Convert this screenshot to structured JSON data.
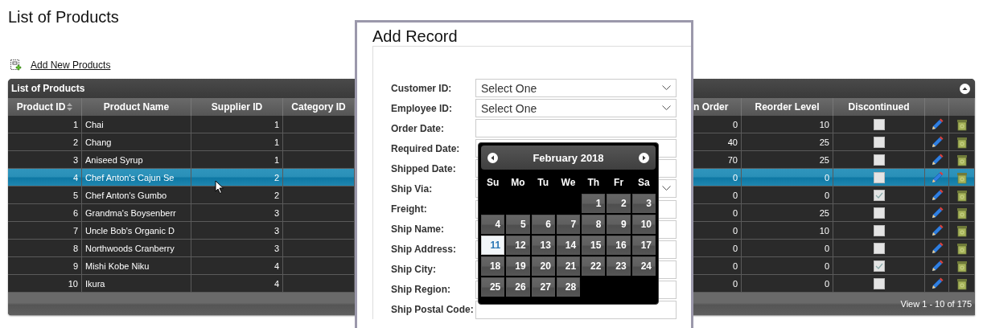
{
  "page_title": "List of Products",
  "add_link": "Add New Products",
  "grid": {
    "caption": "List of Products",
    "columns": [
      {
        "label": "Product ID",
        "sort_icon": true
      },
      {
        "label": "Product Name",
        "sort_icon": false
      },
      {
        "label": "Supplier ID",
        "sort_icon": false
      },
      {
        "label": "Category ID",
        "sort_icon": false
      },
      {
        "label": "n Order",
        "sort_icon": false
      },
      {
        "label": "Reorder Level",
        "sort_icon": false
      },
      {
        "label": "Discontinued",
        "sort_icon": false
      }
    ],
    "rows": [
      {
        "product_id": "1",
        "product_name": "Chai",
        "supplier_id": "1",
        "on_order": "0",
        "reorder_level": "10",
        "discontinued": false,
        "selected": false
      },
      {
        "product_id": "2",
        "product_name": "Chang",
        "supplier_id": "1",
        "on_order": "40",
        "reorder_level": "25",
        "discontinued": false,
        "selected": false
      },
      {
        "product_id": "3",
        "product_name": "Aniseed Syrup",
        "supplier_id": "1",
        "on_order": "70",
        "reorder_level": "25",
        "discontinued": false,
        "selected": false
      },
      {
        "product_id": "4",
        "product_name": "Chef Anton's Cajun Se",
        "supplier_id": "2",
        "on_order": "0",
        "reorder_level": "0",
        "discontinued": false,
        "selected": true
      },
      {
        "product_id": "5",
        "product_name": "Chef Anton's Gumbo",
        "supplier_id": "2",
        "on_order": "0",
        "reorder_level": "0",
        "discontinued": true,
        "selected": false
      },
      {
        "product_id": "6",
        "product_name": "Grandma's Boysenberr",
        "supplier_id": "3",
        "on_order": "0",
        "reorder_level": "25",
        "discontinued": false,
        "selected": false
      },
      {
        "product_id": "7",
        "product_name": "Uncle Bob's Organic D",
        "supplier_id": "3",
        "on_order": "0",
        "reorder_level": "10",
        "discontinued": false,
        "selected": false
      },
      {
        "product_id": "8",
        "product_name": "Northwoods Cranberry",
        "supplier_id": "3",
        "on_order": "0",
        "reorder_level": "0",
        "discontinued": false,
        "selected": false
      },
      {
        "product_id": "9",
        "product_name": "Mishi Kobe Niku",
        "supplier_id": "4",
        "on_order": "0",
        "reorder_level": "0",
        "discontinued": true,
        "selected": false
      },
      {
        "product_id": "10",
        "product_name": "Ikura",
        "supplier_id": "4",
        "on_order": "0",
        "reorder_level": "0",
        "discontinued": false,
        "selected": false
      }
    ],
    "pager": "View 1 - 10 of 175"
  },
  "modal": {
    "title": "Add Record",
    "fields": [
      {
        "label": "Customer ID:",
        "kind": "select",
        "value": "Select One"
      },
      {
        "label": "Employee ID:",
        "kind": "select",
        "value": "Select One"
      },
      {
        "label": "Order Date:",
        "kind": "text"
      },
      {
        "label": "Required Date:",
        "kind": "text"
      },
      {
        "label": "Shipped Date:",
        "kind": "text"
      },
      {
        "label": "Ship Via:",
        "kind": "select"
      },
      {
        "label": "Freight:",
        "kind": "text"
      },
      {
        "label": "Ship Name:",
        "kind": "text"
      },
      {
        "label": "Ship Address:",
        "kind": "text"
      },
      {
        "label": "Ship City:",
        "kind": "text"
      },
      {
        "label": "Ship Region:",
        "kind": "text"
      },
      {
        "label": "Ship Postal Code:",
        "kind": "text"
      }
    ],
    "calendar": {
      "month": "February 2018",
      "weekdays": [
        "Su",
        "Mo",
        "Tu",
        "We",
        "Th",
        "Fr",
        "Sa"
      ],
      "weeks": [
        [
          {
            "kind": "blank"
          },
          {
            "kind": "blank"
          },
          {
            "kind": "blank"
          },
          {
            "kind": "blank"
          },
          {
            "day": "1",
            "selected": false
          },
          {
            "day": "2",
            "selected": false
          },
          {
            "day": "3",
            "selected": false
          }
        ],
        [
          {
            "day": "4",
            "selected": false
          },
          {
            "day": "5",
            "selected": false
          },
          {
            "day": "6",
            "selected": false
          },
          {
            "day": "7",
            "selected": false
          },
          {
            "day": "8",
            "selected": false
          },
          {
            "day": "9",
            "selected": false
          },
          {
            "day": "10",
            "selected": false
          }
        ],
        [
          {
            "day": "11",
            "selected": true
          },
          {
            "day": "12",
            "selected": false
          },
          {
            "day": "13",
            "selected": false
          },
          {
            "day": "14",
            "selected": false
          },
          {
            "day": "15",
            "selected": false
          },
          {
            "day": "16",
            "selected": false
          },
          {
            "day": "17",
            "selected": false
          }
        ],
        [
          {
            "day": "18",
            "selected": false
          },
          {
            "day": "19",
            "selected": false
          },
          {
            "day": "20",
            "selected": false
          },
          {
            "day": "21",
            "selected": false
          },
          {
            "day": "22",
            "selected": false
          },
          {
            "day": "23",
            "selected": false
          },
          {
            "day": "24",
            "selected": false
          }
        ],
        [
          {
            "day": "25",
            "selected": false
          },
          {
            "day": "26",
            "selected": false
          },
          {
            "day": "27",
            "selected": false
          },
          {
            "day": "28",
            "selected": false
          },
          {
            "kind": "blank"
          },
          {
            "kind": "blank"
          },
          {
            "kind": "blank"
          }
        ]
      ]
    }
  }
}
